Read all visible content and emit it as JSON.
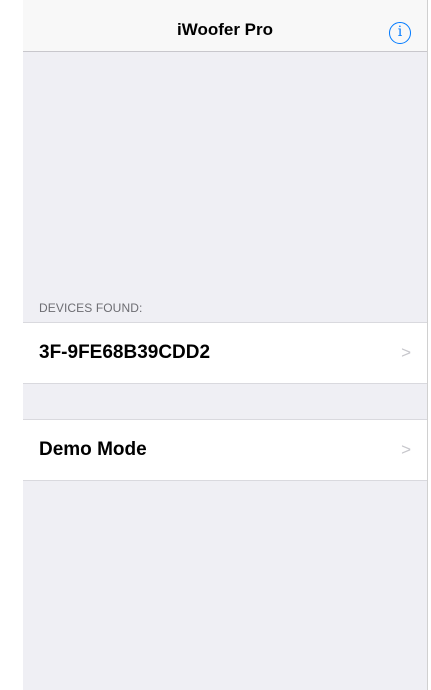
{
  "navbar": {
    "title": "iWoofer Pro",
    "info_icon": "info-circle-icon",
    "info_glyph": "i"
  },
  "devices_section": {
    "header": "DEVICES FOUND:",
    "items": [
      {
        "label": "3F-9FE68B39CDD2",
        "chevron": ">"
      }
    ]
  },
  "demo_section": {
    "label": "Demo Mode",
    "chevron": ">"
  },
  "colors": {
    "accent": "#007aff",
    "background": "#efeff4",
    "secondary_text": "#6d6d72",
    "chevron": "#c7c7cc"
  }
}
